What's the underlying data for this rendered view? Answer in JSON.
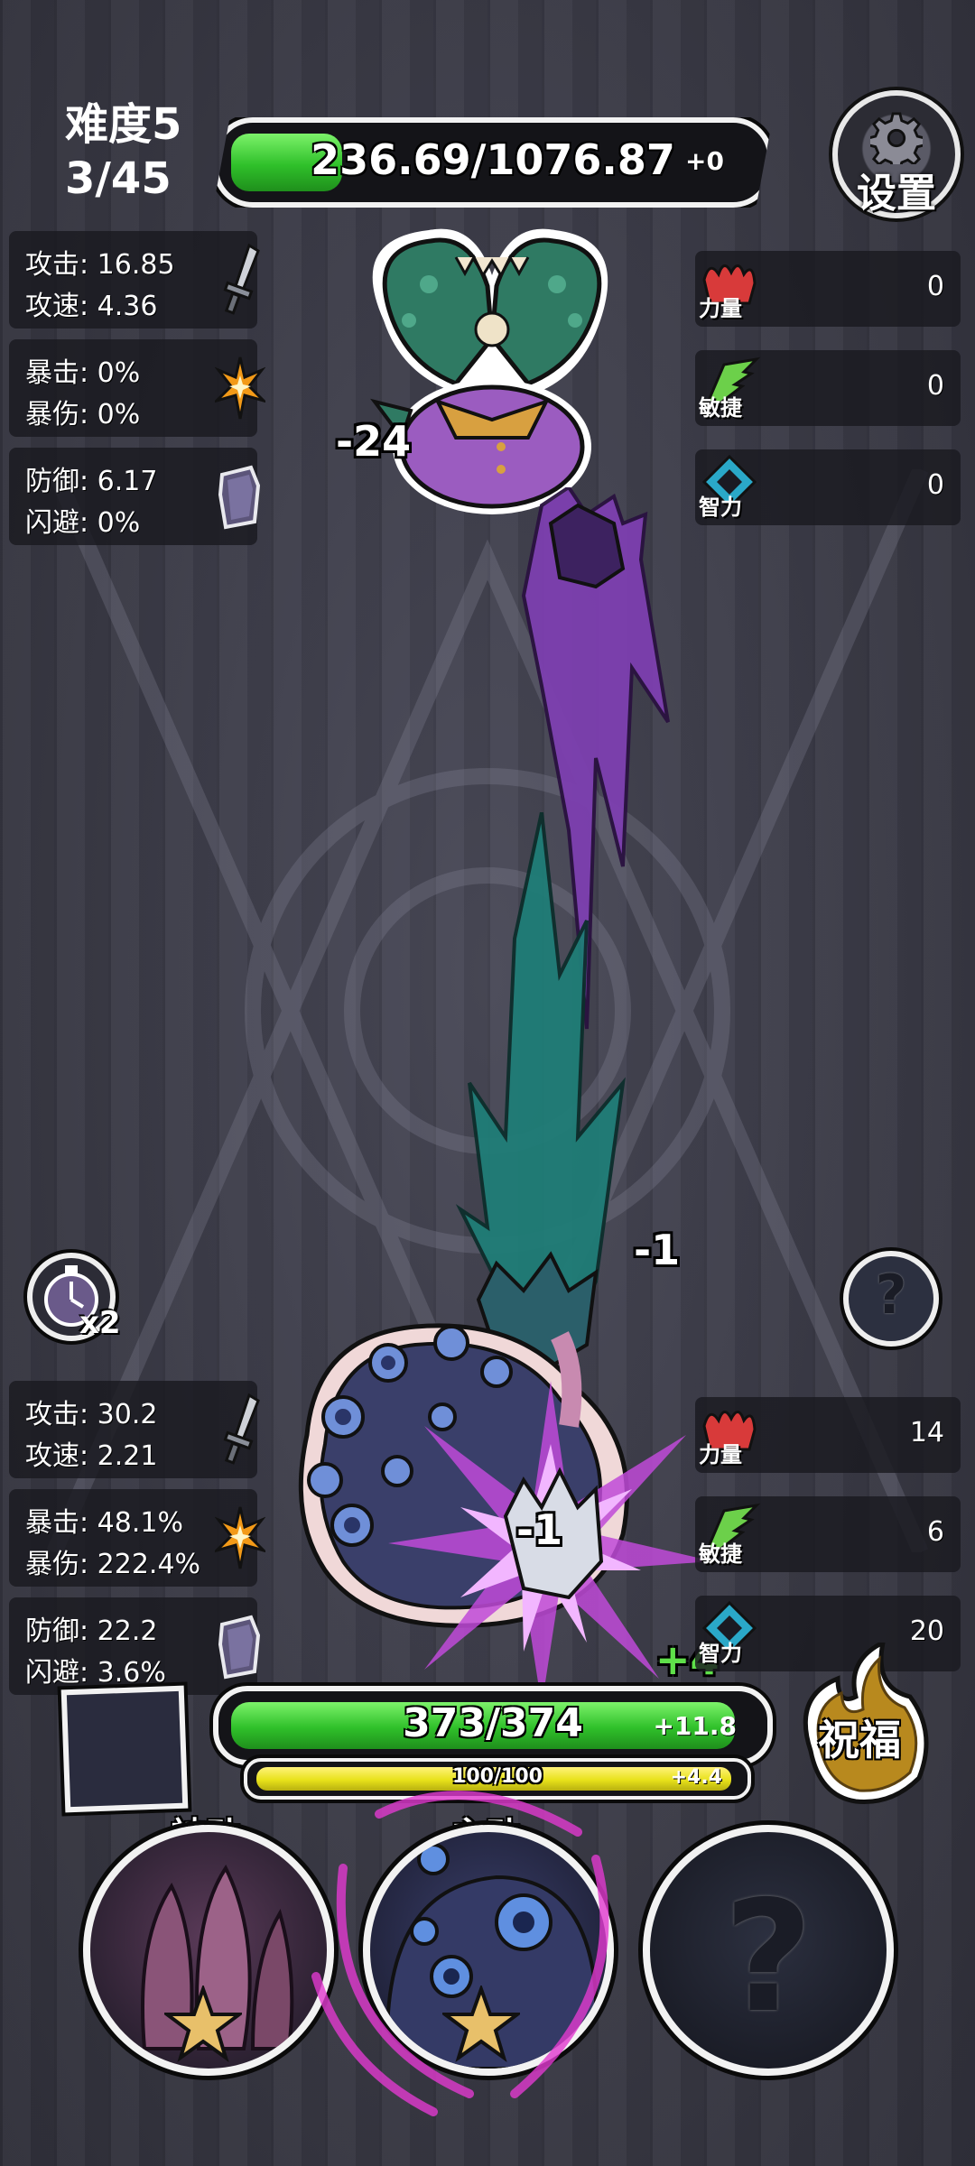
{
  "header": {
    "difficulty": "难度5",
    "wave": "3/45",
    "settings_label": "设置"
  },
  "enemy": {
    "hp_text": "236.69/1076.87",
    "hp_fraction": 0.22,
    "regen": "+0",
    "damage_popup": "-24",
    "stats": [
      {
        "line1": "攻击: 16.85",
        "line2": "攻速: 4.36",
        "icon": "sword-icon"
      },
      {
        "line1": "暴击: 0%",
        "line2": "暴伤: 0%",
        "icon": "crit-burst-icon"
      },
      {
        "line1": "防御: 6.17",
        "line2": "闪避: 0%",
        "icon": "shield-icon"
      }
    ],
    "attributes": [
      {
        "name": "力量",
        "value": "0",
        "icon": "strength-fist-icon"
      },
      {
        "name": "敏捷",
        "value": "0",
        "icon": "agility-wing-icon"
      },
      {
        "name": "智力",
        "value": "0",
        "icon": "intellect-gem-icon"
      }
    ]
  },
  "player": {
    "hp_text": "373/374",
    "hp_fraction": 0.997,
    "hp_regen": "+11.8",
    "mp_text": "100/100",
    "mp_fraction": 1.0,
    "mp_regen": "+4.4",
    "damage_popup_1": "-1",
    "damage_popup_2": "-1",
    "heal_popup": "+4",
    "stats": [
      {
        "line1": "攻击: 30.2",
        "line2": "攻速: 2.21",
        "icon": "sword-icon"
      },
      {
        "line1": "暴击: 48.1%",
        "line2": "暴伤: 222.4%",
        "icon": "crit-burst-icon"
      },
      {
        "line1": "防御: 22.2",
        "line2": "闪避: 3.6%",
        "icon": "shield-icon"
      }
    ],
    "attributes": [
      {
        "name": "力量",
        "value": "14",
        "icon": "strength-fist-icon"
      },
      {
        "name": "敏捷",
        "value": "6",
        "icon": "agility-wing-icon"
      },
      {
        "name": "智力",
        "value": "20",
        "icon": "intellect-gem-icon"
      }
    ]
  },
  "controls": {
    "speed_label": "x2",
    "help_icon": "question-icon",
    "blessing_label": "祝福"
  },
  "skills": {
    "passive_label": "被动",
    "active_label": "主动"
  },
  "colors": {
    "hp_green": "#2fc02a",
    "mp_yellow": "#e8e21a",
    "enemy_purple": "#8a4fb8",
    "player_blue": "#4a5aa0"
  }
}
